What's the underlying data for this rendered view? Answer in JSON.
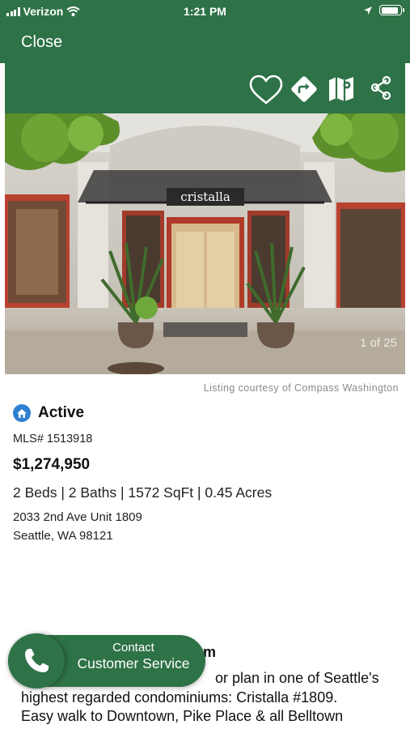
{
  "status_bar": {
    "carrier": "Verizon",
    "time": "1:21 PM",
    "battery_level": 0.9
  },
  "nav": {
    "close_label": "Close"
  },
  "actions": [
    "heart-icon",
    "directions-icon",
    "map-icon",
    "share-icon"
  ],
  "photo": {
    "sign_text": "cristalla",
    "counter": "1 of 25"
  },
  "courtesy": "Listing courtesy of Compass Washington",
  "listing": {
    "status": "Active",
    "mls": "MLS# 1513918",
    "price": "$1,274,950",
    "specs": "2 Beds | 2 Baths | 1572 SqFt | 0.45 Acres",
    "address_line1": "2033 2nd Ave Unit 1809",
    "address_line2": "Seattle, WA 98121"
  },
  "description": {
    "heading_partial": "um",
    "line1_partial": "or plan in one of Seattle's",
    "line2": "highest regarded condominiums: Cristalla #1809.",
    "line3": "Easy walk to Downtown, Pike Place & all Belltown"
  },
  "contact": {
    "line1": "Contact",
    "line2": "Customer Service"
  },
  "colors": {
    "brand_green": "#2e7247",
    "status_blue": "#2f80d1"
  }
}
